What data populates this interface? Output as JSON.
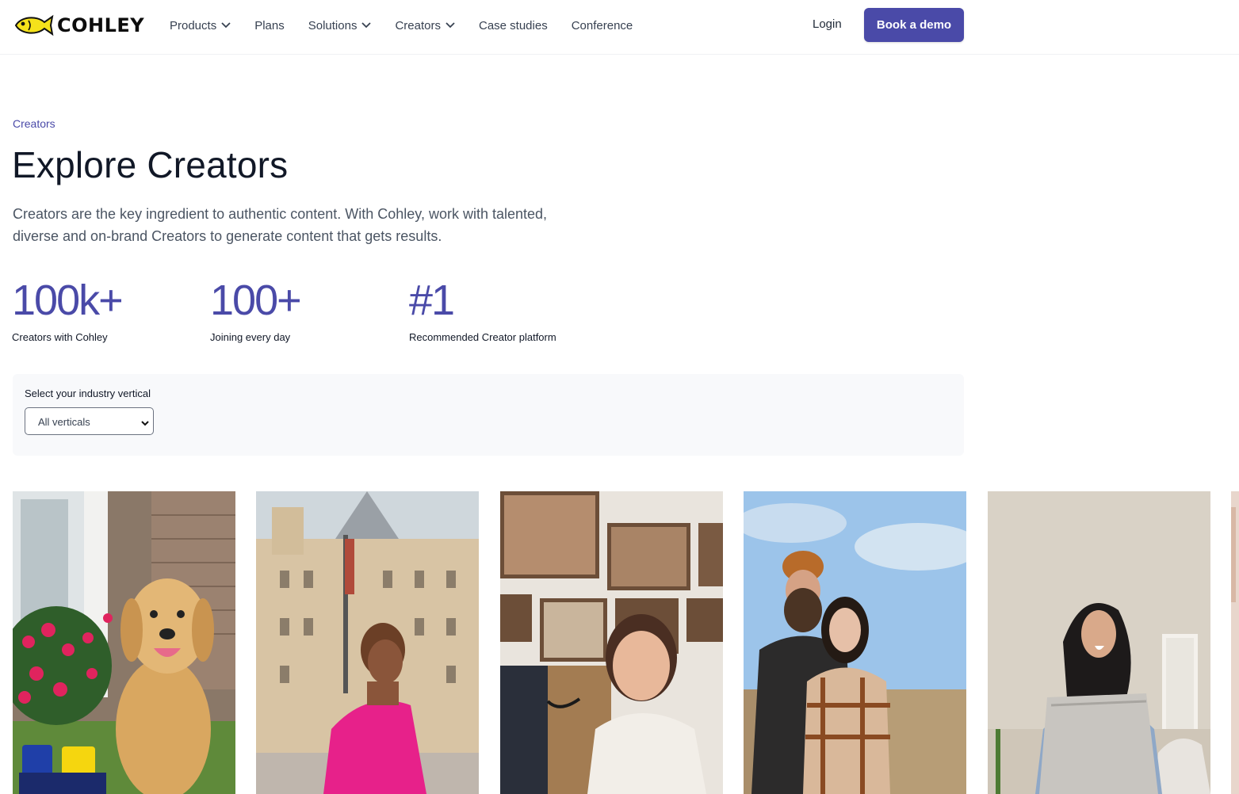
{
  "header": {
    "logo_text": "COHLEY",
    "nav": [
      {
        "label": "Products",
        "has_dropdown": true
      },
      {
        "label": "Plans",
        "has_dropdown": false
      },
      {
        "label": "Solutions",
        "has_dropdown": true
      },
      {
        "label": "Creators",
        "has_dropdown": true
      },
      {
        "label": "Case studies",
        "has_dropdown": false
      },
      {
        "label": "Conference",
        "has_dropdown": false
      }
    ],
    "login_label": "Login",
    "demo_label": "Book a demo"
  },
  "hero": {
    "eyebrow": "Creators",
    "title": "Explore Creators",
    "lead": "Creators are the key ingredient to authentic content. With Cohley, work with talented, diverse and on-brand Creators to generate content that gets results."
  },
  "stats": [
    {
      "value": "100k+",
      "label": "Creators with Cohley"
    },
    {
      "value": "100+",
      "label": "Joining every day"
    },
    {
      "value": "#1",
      "label": "Recommended Creator platform"
    }
  ],
  "filter": {
    "label": "Select your industry vertical",
    "selected": "All verticals"
  },
  "creators": [
    {
      "image": "golden retriever sitting by pink flowers with finn product jars"
    },
    {
      "image": "woman in pink one-shoulder dress in front of stone castle building"
    },
    {
      "image": "woman with amazon box in front of framed family photo wall"
    },
    {
      "image": "bearded man in beanie and woman in plaid coat under blue sky"
    },
    {
      "image": "smiling woman holding a silver package in a room"
    }
  ],
  "colors": {
    "brand": "#4a4aa8",
    "logo_fish": "#f5e21b",
    "panel_bg": "#f8f9fb"
  }
}
